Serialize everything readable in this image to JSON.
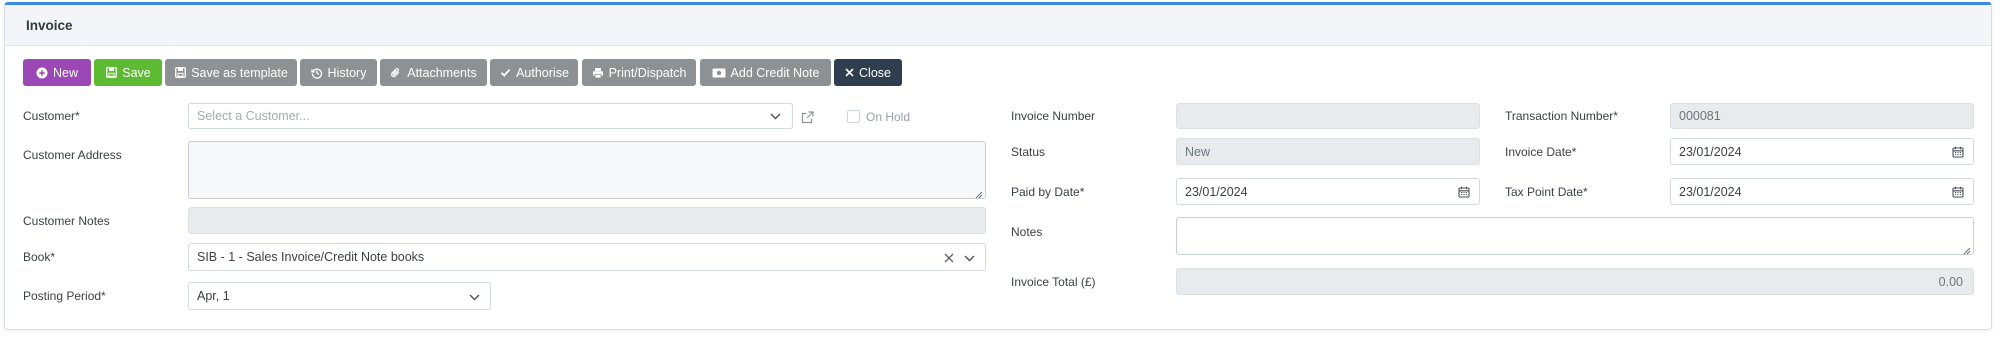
{
  "panel": {
    "title": "Invoice"
  },
  "toolbar": {
    "new": "New",
    "save": "Save",
    "save_template": "Save as template",
    "history": "History",
    "attachments": "Attachments",
    "authorise": "Authorise",
    "print_dispatch": "Print/Dispatch",
    "add_credit_note": "Add Credit Note",
    "close": "Close"
  },
  "form": {
    "customer": {
      "label": "Customer*",
      "placeholder": "Select a Customer..."
    },
    "on_hold": {
      "label": "On Hold",
      "checked": false
    },
    "customer_address": {
      "label": "Customer Address",
      "value": ""
    },
    "customer_notes": {
      "label": "Customer Notes",
      "value": ""
    },
    "book": {
      "label": "Book*",
      "value": "SIB - 1 - Sales Invoice/Credit Note books"
    },
    "posting_period": {
      "label": "Posting Period*",
      "value": "Apr, 1"
    },
    "invoice_number": {
      "label": "Invoice Number",
      "value": ""
    },
    "status": {
      "label": "Status",
      "value": "New"
    },
    "paid_by_date": {
      "label": "Paid by Date*",
      "value": "23/01/2024"
    },
    "notes": {
      "label": "Notes",
      "value": ""
    },
    "invoice_total": {
      "label": "Invoice Total (£)",
      "value": "0.00"
    },
    "transaction_number": {
      "label": "Transaction Number*",
      "value": "000081"
    },
    "invoice_date": {
      "label": "Invoice Date*",
      "value": "23/01/2024"
    },
    "tax_point_date": {
      "label": "Tax Point Date*",
      "value": "23/01/2024"
    }
  },
  "colors": {
    "accent": "#3b8be0",
    "new_button": "#9b47b5",
    "save_button": "#5dbb33",
    "secondary_button": "#8e9194",
    "close_button": "#2f3e4e"
  },
  "icons": {
    "new": "plus-circle-icon",
    "save": "floppy-disk-icon",
    "save_template": "floppy-disk-icon",
    "history": "history-icon",
    "attachments": "paperclip-icon",
    "authorise": "check-icon",
    "print": "printer-icon",
    "credit_note": "money-bill-icon",
    "close": "close-icon",
    "dropdown": "chevron-down-icon",
    "external_link": "external-link-icon",
    "clear": "clear-icon",
    "calendar": "calendar-icon"
  }
}
